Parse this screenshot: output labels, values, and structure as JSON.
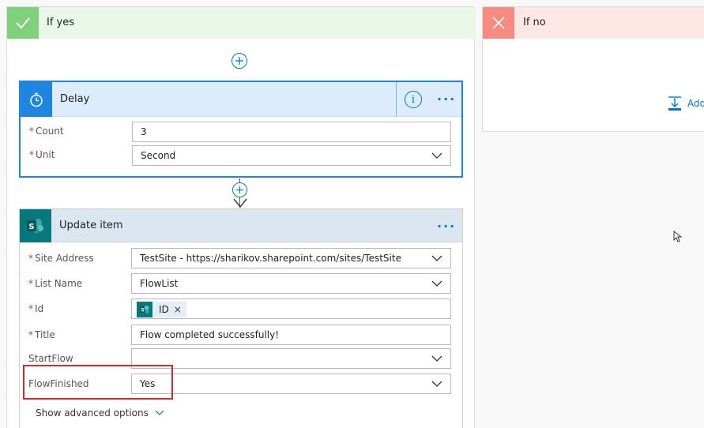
{
  "branches": {
    "yes": {
      "title": "If yes",
      "accent": "#7fd17a"
    },
    "no": {
      "title": "If no",
      "accent": "#f58b82",
      "add_action_label": "Add"
    }
  },
  "delay": {
    "title": "Delay",
    "accent": "#1f86e0",
    "fields": {
      "count": {
        "label": "Count",
        "value": "3",
        "required": "*"
      },
      "unit": {
        "label": "Unit",
        "value": "Second",
        "required": "*"
      }
    }
  },
  "update_item": {
    "title": "Update item",
    "accent": "#07787c",
    "fields": {
      "site_address": {
        "label": "Site Address",
        "value": "TestSite - https://sharikov.sharepoint.com/sites/TestSite",
        "required": "*"
      },
      "list_name": {
        "label": "List Name",
        "value": "FlowList",
        "required": "*"
      },
      "id": {
        "label": "Id",
        "token": "ID",
        "required": "*"
      },
      "title": {
        "label": "Title",
        "value": "Flow completed successfully!",
        "required": "*"
      },
      "start_flow": {
        "label": "StartFlow",
        "value": ""
      },
      "flow_finished": {
        "label": "FlowFinished",
        "value": "Yes"
      }
    },
    "show_advanced": "Show advanced options"
  },
  "icons": {
    "yes": "checkmark-icon",
    "no": "close-icon",
    "delay": "timer-icon",
    "update": "sharepoint-icon",
    "insert": "insert-step-icon"
  },
  "more_label": "···",
  "info_label": "i",
  "token_close": "×"
}
